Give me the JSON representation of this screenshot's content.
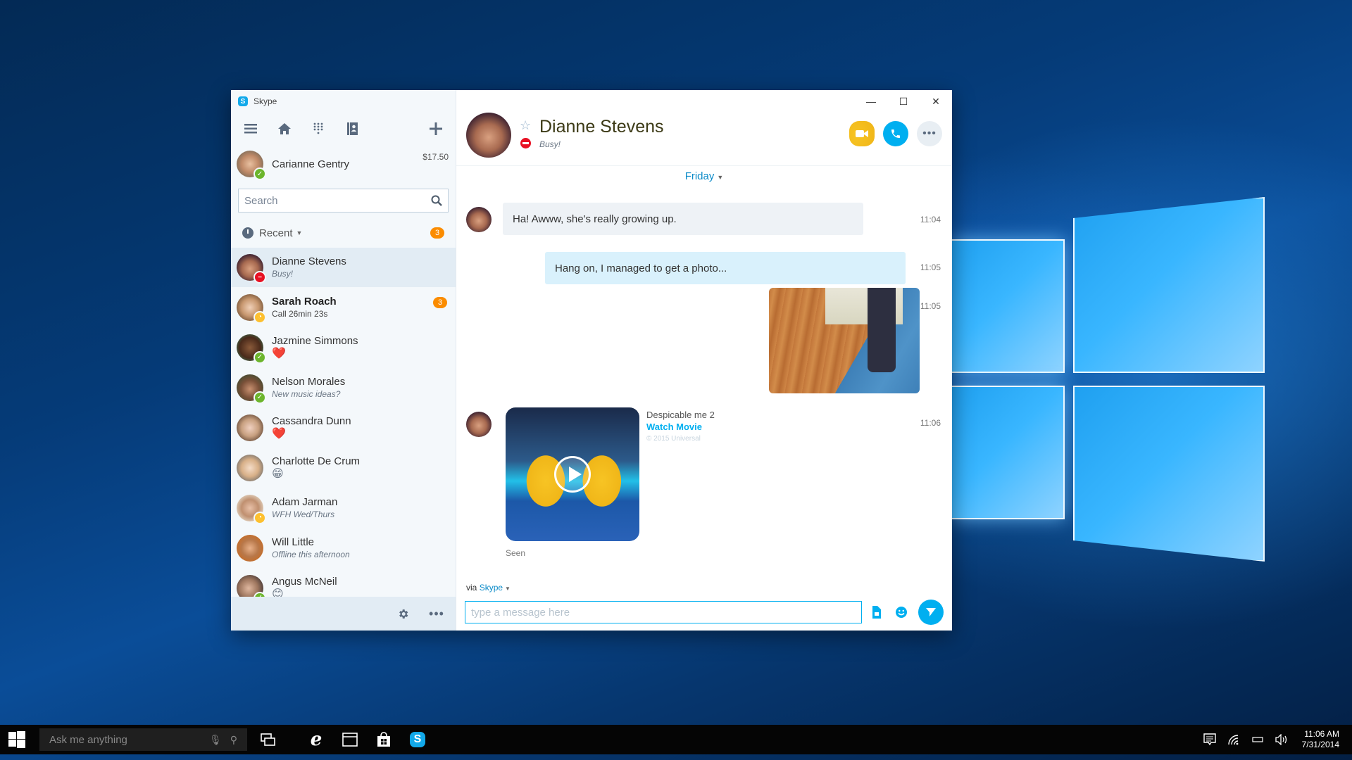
{
  "window": {
    "app_title": "Skype",
    "controls": {
      "minimize": "—",
      "maximize": "☐",
      "close": "✕"
    }
  },
  "sidebar": {
    "toolbar_icons": [
      "menu-icon",
      "home-icon",
      "dialpad-icon",
      "contacts-book-icon",
      "add-icon"
    ],
    "profile": {
      "name": "Carianne Gentry",
      "status": "online",
      "balance": "$17.50"
    },
    "search": {
      "placeholder": "Search",
      "value": ""
    },
    "recent": {
      "label": "Recent",
      "badge": "3"
    },
    "contacts": [
      {
        "name": "Dianne Stevens",
        "sub": "Busy!",
        "status": "busy",
        "selected": true,
        "sub_style": "italic"
      },
      {
        "name": "Sarah Roach",
        "sub": "Call 26min 23s",
        "status": "away",
        "badge": "3",
        "bold": true,
        "sub_style": "plain"
      },
      {
        "name": "Jazmine Simmons",
        "sub": "❤️",
        "status": "online",
        "sub_style": "emoji"
      },
      {
        "name": "Nelson Morales",
        "sub": "New music ideas?",
        "status": "online",
        "sub_style": "italic"
      },
      {
        "name": "Cassandra Dunn",
        "sub": "❤️",
        "status": "none",
        "sub_style": "emoji"
      },
      {
        "name": "Charlotte De Crum",
        "sub": "😁",
        "status": "none",
        "sub_style": "emoji"
      },
      {
        "name": "Adam Jarman",
        "sub": "WFH Wed/Thurs",
        "status": "away",
        "sub_style": "italic"
      },
      {
        "name": "Will Little",
        "sub": "Offline this afternoon",
        "status": "none",
        "sub_style": "italic"
      },
      {
        "name": "Angus McNeil",
        "sub": "😊",
        "status": "online",
        "sub_style": "emoji"
      }
    ],
    "footer": {
      "settings_icon": "gear-icon",
      "more_label": "•••"
    }
  },
  "chat": {
    "contact_name": "Dianne Stevens",
    "mood": "Busy!",
    "status": "busy",
    "header_buttons": [
      "video-call",
      "audio-call",
      "more"
    ],
    "more_label": "•••",
    "day_label": "Friday",
    "messages": [
      {
        "direction": "in",
        "text": "Ha! Awww, she's really growing up.",
        "time": "11:04"
      },
      {
        "direction": "out",
        "text": "Hang on, I managed to get a photo...",
        "time": "11:05"
      },
      {
        "direction": "out",
        "type": "photo",
        "time": "11:05"
      },
      {
        "direction": "in",
        "type": "video",
        "title": "Despicable me 2",
        "link": "Watch Movie",
        "copyright": "© 2015 Universal",
        "time": "11:06"
      }
    ],
    "seen_label": "Seen",
    "via_prefix": "via",
    "via_service": "Skype",
    "compose": {
      "placeholder": "type a message here",
      "value": ""
    }
  },
  "taskbar": {
    "search_placeholder": "Ask me anything",
    "apps": [
      "task-view",
      "edge",
      "file-explorer",
      "store",
      "skype"
    ],
    "tray": {
      "time": "11:06 AM",
      "date": "7/31/2014"
    }
  },
  "colors": {
    "accent": "#00aff0",
    "busy": "#e81123",
    "online": "#6cb52c",
    "away": "#fdc02f",
    "badge": "#fb8c00"
  }
}
